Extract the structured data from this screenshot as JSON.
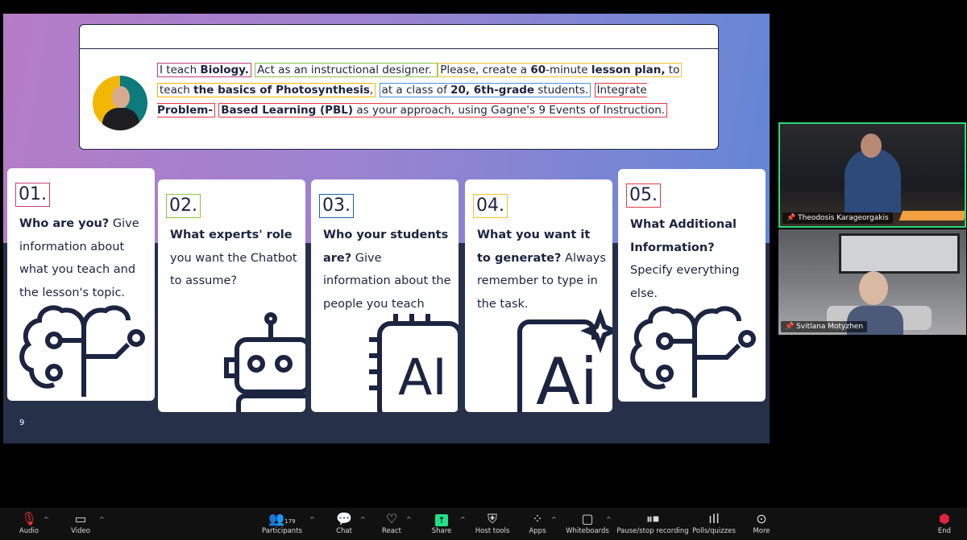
{
  "slide": {
    "prompt": {
      "segments": [
        {
          "pre": "I teach ",
          "bold": "Biology.",
          "post": "",
          "color": "#c2407e"
        },
        {
          "pre": "Act as an instructional designer. ",
          "bold": "",
          "post": "",
          "color": "#8bc34a"
        },
        {
          "pre": "Please, create a ",
          "bold": "60",
          "post": "-minute ",
          "bold2": "lesson plan,",
          "post2": " to",
          "color": "#f2c230"
        },
        {
          "pre": "teach ",
          "bold": "the basics of Photosynthesis",
          "post": ",",
          "color": "#f2b705"
        },
        {
          "pre": "at a class of ",
          "bold": "20, 6th-grade",
          "post": " students.",
          "color": "#4a90e2"
        },
        {
          "pre": "Integrate ",
          "bold": "Problem-",
          "post": "",
          "color": "#e53945"
        },
        {
          "pre": "",
          "bold": "Based Learning (PBL)",
          "post": " as your approach, using Gagne's 9 Events of Instruction.",
          "color": "#e53945"
        }
      ]
    },
    "cards": [
      {
        "num": "01.",
        "bold": "Who are you?",
        "text": " Give information about what you teach and the lesson's topic.",
        "color": "#c2407e",
        "icon": "brain-circuit-icon"
      },
      {
        "num": "02.",
        "bold": "What experts' role",
        "text": " you want the Chatbot to assume?",
        "color": "#8bc34a",
        "icon": "robot-icon"
      },
      {
        "num": "03.",
        "bold": "Who your students are?",
        "text": " Give information about the people you teach",
        "color": "#1f5fa8",
        "icon": "ai-chip-icon"
      },
      {
        "num": "04.",
        "bold": "What you want it to generate?",
        "text": " Always remember to type in the task.",
        "color": "#f2c230",
        "icon": "ai-sparkle-icon"
      },
      {
        "num": "05.",
        "bold": "What Additional Information?",
        "text": " Specify everything else.",
        "color": "#e53945",
        "icon": "brain-circuit-icon"
      }
    ],
    "page_number": "9"
  },
  "participants_video": [
    {
      "name": "Theodosis Karageorgakis",
      "active": true
    },
    {
      "name": "Svitlana Motyzhen",
      "active": false
    }
  ],
  "toolbar": {
    "audio": "Audio",
    "video": "Video",
    "participants": "Participants",
    "participants_count": "179",
    "chat": "Chat",
    "react": "React",
    "share": "Share",
    "host_tools": "Host tools",
    "apps": "Apps",
    "whiteboards": "Whiteboards",
    "recording": "Pause/stop recording",
    "polls": "Polls/quizzes",
    "more": "More",
    "end": "End",
    "share_color": "#22e08a",
    "end_color": "#e0243a"
  }
}
